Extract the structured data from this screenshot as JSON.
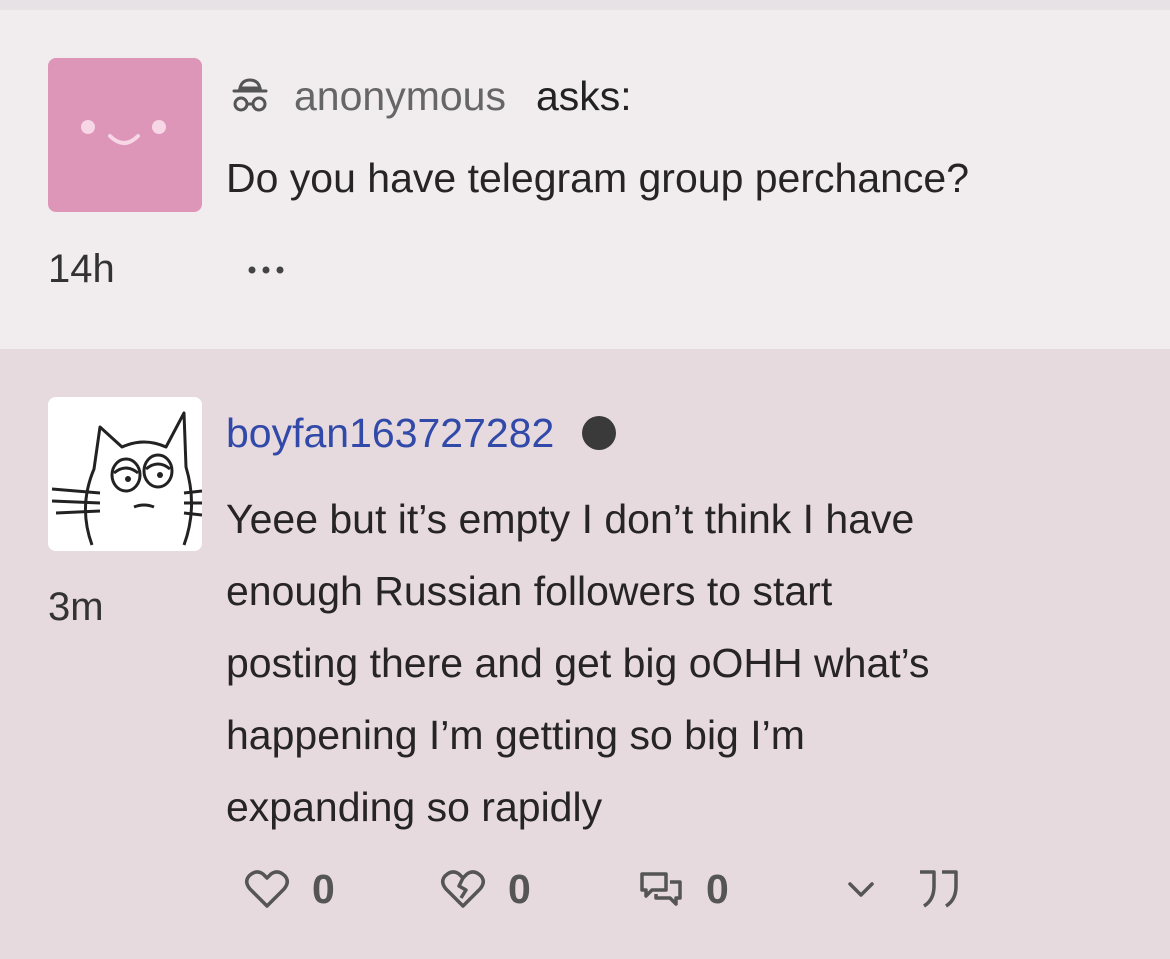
{
  "question": {
    "asker_name": "anonymous",
    "asks_label": "asks:",
    "text": "Do you have telegram group perchance?",
    "timestamp": "14h",
    "more_label": "more-options",
    "avatar_color": "#dd95b8"
  },
  "answer": {
    "username": "boyfan163727282",
    "timestamp": "3m",
    "lines": [
      "Yeee but it’s empty I don’t think I have",
      "enough Russian followers to start",
      "posting there and get big oOHH what’s",
      "happening I’m getting so big I’m",
      "expanding so rapidly"
    ],
    "username_color": "#3149a8"
  },
  "actions": {
    "like_count": "0",
    "dislike_count": "0",
    "comment_count": "0",
    "icons": [
      "heart-icon",
      "broken-heart-icon",
      "comment-icon",
      "chevron-down-icon",
      "quote-icon"
    ]
  }
}
